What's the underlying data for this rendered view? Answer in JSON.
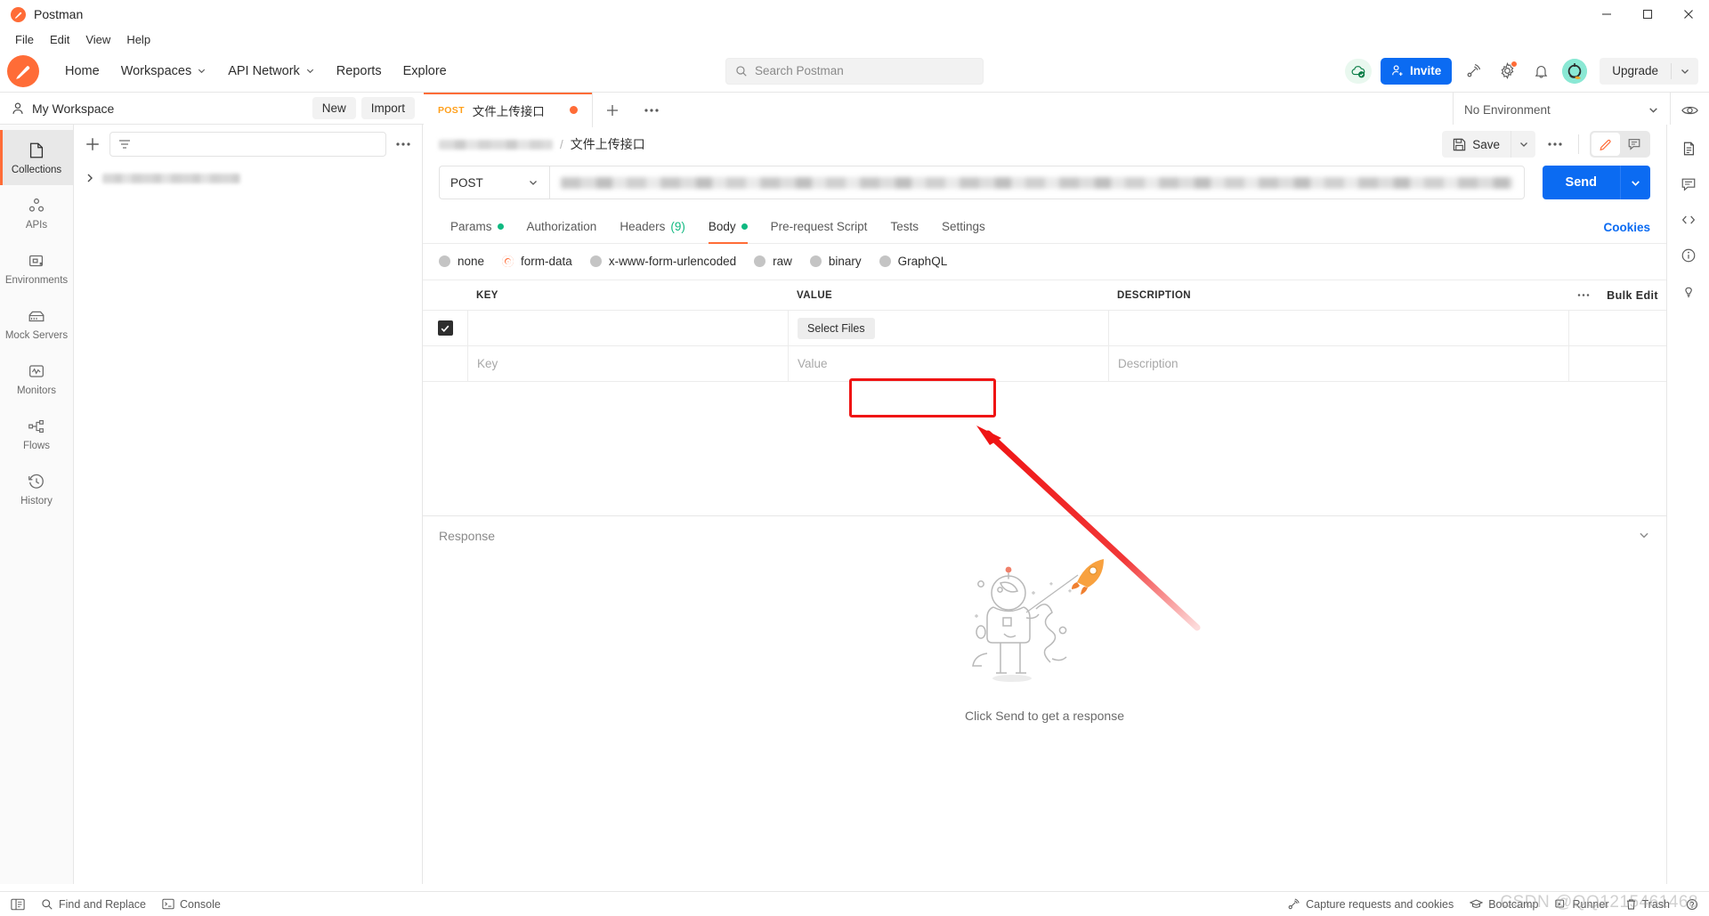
{
  "window": {
    "app_title": "Postman",
    "minimize": "minimize-icon",
    "maximize": "maximize-icon",
    "close": "close-icon"
  },
  "menubar": {
    "items": [
      "File",
      "Edit",
      "View",
      "Help"
    ]
  },
  "header": {
    "nav": [
      {
        "label": "Home",
        "caret": false
      },
      {
        "label": "Workspaces",
        "caret": true
      },
      {
        "label": "API Network",
        "caret": true
      },
      {
        "label": "Reports",
        "caret": false
      },
      {
        "label": "Explore",
        "caret": false
      }
    ],
    "search_placeholder": "Search Postman",
    "invite_label": "Invite",
    "upgrade_label": "Upgrade",
    "icons": [
      "cloud-sync-ok-icon",
      "satellite-icon",
      "settings-gear-icon",
      "notifications-bell-icon",
      "user-avatar"
    ]
  },
  "workspace": {
    "name": "My Workspace",
    "new_label": "New",
    "import_label": "Import"
  },
  "sidebar": {
    "items": [
      {
        "label": "Collections",
        "icon": "collections-icon",
        "active": true
      },
      {
        "label": "APIs",
        "icon": "apis-icon",
        "active": false
      },
      {
        "label": "Environments",
        "icon": "environments-icon",
        "active": false
      },
      {
        "label": "Mock Servers",
        "icon": "mock-servers-icon",
        "active": false
      },
      {
        "label": "Monitors",
        "icon": "monitors-icon",
        "active": false
      },
      {
        "label": "Flows",
        "icon": "flows-icon",
        "active": false
      },
      {
        "label": "History",
        "icon": "history-icon",
        "active": false
      }
    ]
  },
  "collections_pane": {
    "add_icon": "plus-icon",
    "filter_icon": "filter-icon",
    "more_icon": "more-horizontal-icon",
    "collection_row_redacted": true
  },
  "tabs": {
    "open": [
      {
        "method": "POST",
        "title": "文件上传接口",
        "unsaved": true,
        "active": true
      }
    ],
    "new_tab_icon": "plus-icon",
    "tab_more_icon": "more-horizontal-icon"
  },
  "environment": {
    "selected": "No Environment",
    "eye_icon": "eye-icon"
  },
  "breadcrumb": {
    "collection_redacted": true,
    "separator": "/",
    "current": "文件上传接口"
  },
  "request_actions": {
    "save_label": "Save",
    "save_icon": "save-disk-icon",
    "save_caret_icon": "chevron-down-icon",
    "more_icon": "more-horizontal-icon",
    "edit_icon": "pencil-icon",
    "comment_icon": "comment-icon"
  },
  "request": {
    "method": "POST",
    "url_redacted": true,
    "send_label": "Send",
    "send_caret_icon": "chevron-down-icon"
  },
  "request_tabs": [
    {
      "label": "Params",
      "dot": true,
      "count": null,
      "active": false
    },
    {
      "label": "Authorization",
      "dot": false,
      "count": null,
      "active": false
    },
    {
      "label": "Headers",
      "dot": false,
      "count": "(9)",
      "active": false
    },
    {
      "label": "Body",
      "dot": true,
      "count": null,
      "active": true
    },
    {
      "label": "Pre-request Script",
      "dot": false,
      "count": null,
      "active": false
    },
    {
      "label": "Tests",
      "dot": false,
      "count": null,
      "active": false
    },
    {
      "label": "Settings",
      "dot": false,
      "count": null,
      "active": false
    }
  ],
  "cookies_link": "Cookies",
  "body_types": [
    {
      "label": "none",
      "selected": false
    },
    {
      "label": "form-data",
      "selected": true
    },
    {
      "label": "x-www-form-urlencoded",
      "selected": false
    },
    {
      "label": "raw",
      "selected": false
    },
    {
      "label": "binary",
      "selected": false
    },
    {
      "label": "GraphQL",
      "selected": false
    }
  ],
  "form_table": {
    "columns": [
      "KEY",
      "VALUE",
      "DESCRIPTION"
    ],
    "more_icon": "more-horizontal-icon",
    "bulk_edit_label": "Bulk Edit",
    "rows": [
      {
        "checked": true,
        "key": "",
        "value_button": "Select Files",
        "description": "",
        "highlighted": true
      }
    ],
    "placeholder_row": {
      "key": "Key",
      "value": "Value",
      "description": "Description"
    }
  },
  "annotation": {
    "box_color": "#ef1414",
    "arrow_color": "#ef1414",
    "points_to": "Select Files"
  },
  "response": {
    "title": "Response",
    "collapse_icon": "chevron-down-icon",
    "empty_caption": "Click Send to get a response",
    "illustration": "astronaut-with-rocket"
  },
  "right_rail": {
    "items": [
      "documentation-icon",
      "comments-icon",
      "code-snippet-icon",
      "info-icon",
      "lightbulb-icon"
    ]
  },
  "statusbar": {
    "left": [
      {
        "label": "",
        "icon": "sidebar-toggle-icon"
      },
      {
        "label": "Find and Replace",
        "icon": "search-icon"
      },
      {
        "label": "Console",
        "icon": "terminal-icon"
      }
    ],
    "right": [
      {
        "label": "Capture requests and cookies",
        "icon": "satellite-icon"
      },
      {
        "label": "Bootcamp",
        "icon": "graduation-cap-icon"
      },
      {
        "label": "Runner",
        "icon": "runner-icon"
      },
      {
        "label": "Trash",
        "icon": "trash-icon"
      },
      {
        "label": "",
        "icon": "help-icon"
      }
    ],
    "watermark": "CSDN @QQ1215461468"
  },
  "colors": {
    "accent_orange": "#ff6c37",
    "blue": "#0b6bf2",
    "green": "#10b981",
    "annotation_red": "#ef1414"
  }
}
